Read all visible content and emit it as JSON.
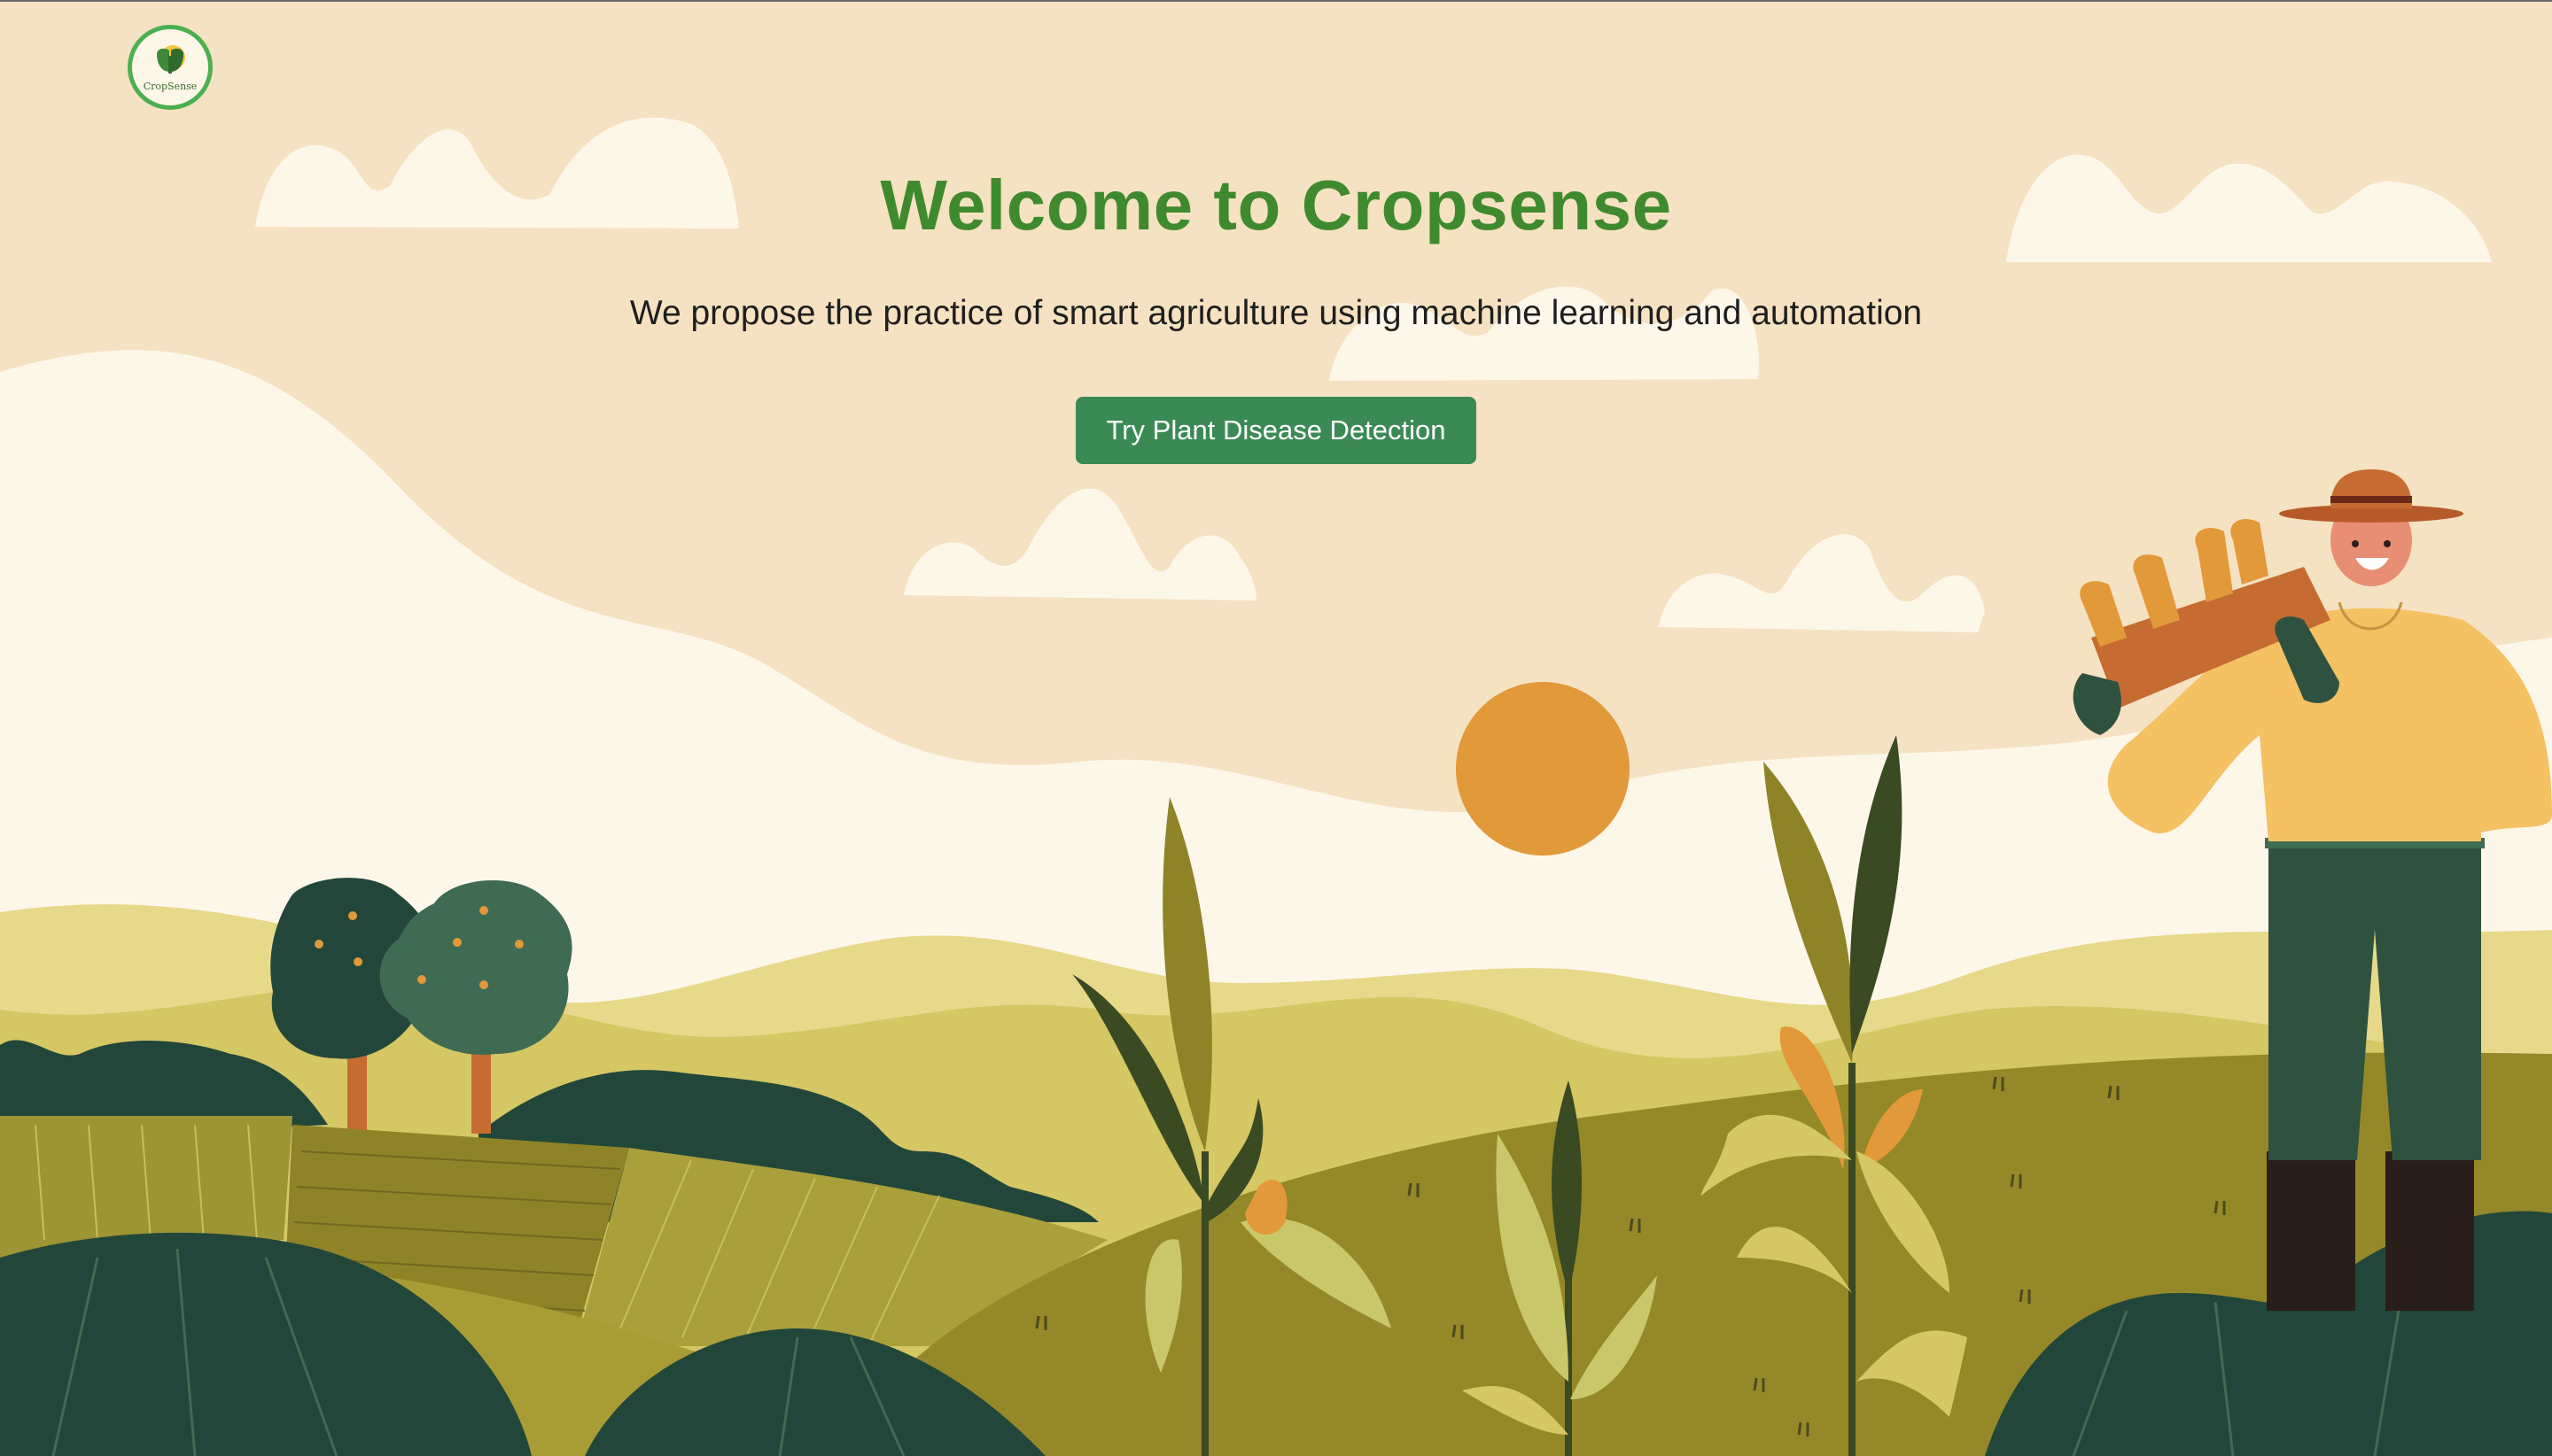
{
  "logo": {
    "text": "CropSense"
  },
  "hero": {
    "title": "Welcome to Cropsense",
    "subtitle": "We propose the practice of smart agriculture using machine learning and automation",
    "cta_label": "Try Plant Disease Detection"
  },
  "colors": {
    "background": "#f5e2c2",
    "title": "#3f8a2e",
    "button": "#3b8a55",
    "sun": "#e2993a"
  }
}
